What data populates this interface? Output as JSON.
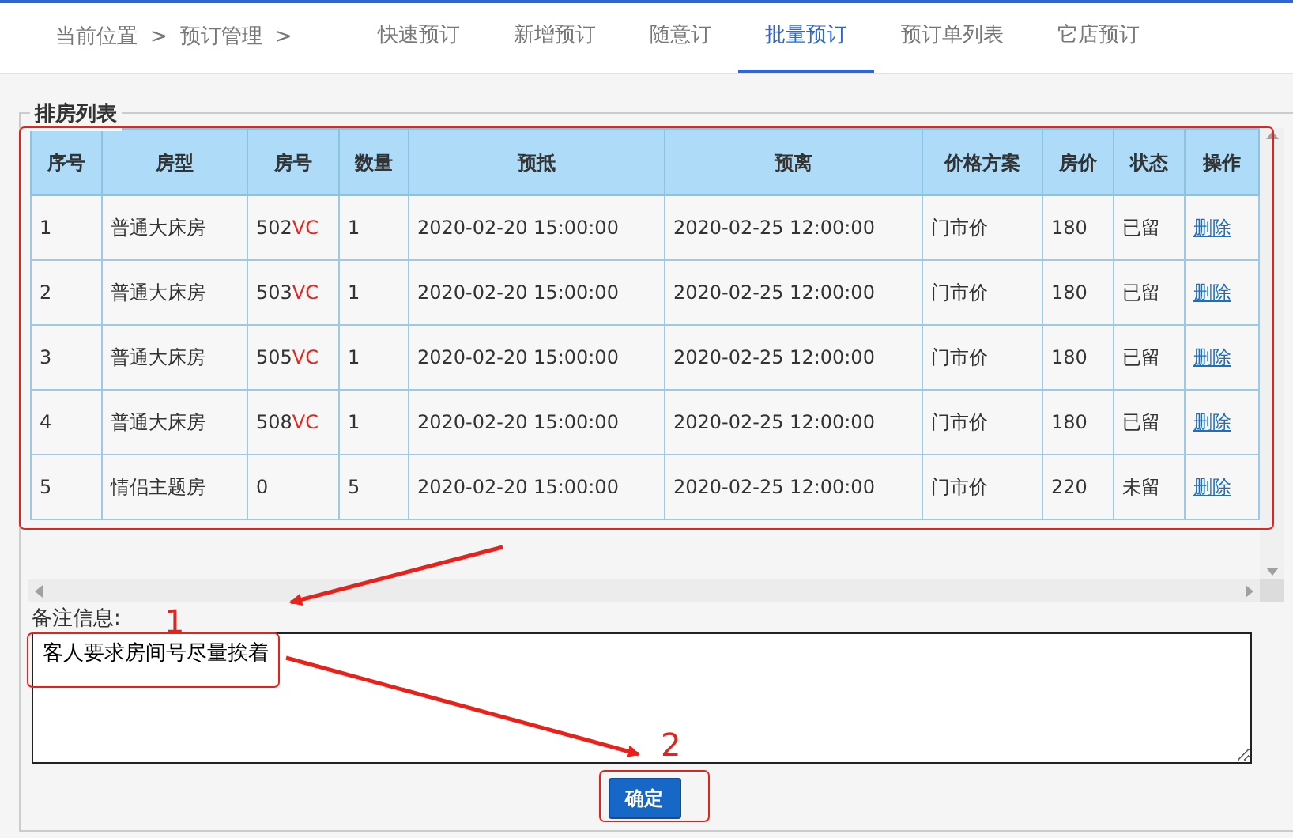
{
  "breadcrumb": [
    "当前位置",
    ">",
    "预订管理",
    ">"
  ],
  "tabs": [
    {
      "label": "快速预订",
      "selected": false
    },
    {
      "label": "新增预订",
      "selected": false
    },
    {
      "label": "随意订",
      "selected": false
    },
    {
      "label": "批量预订",
      "selected": true
    },
    {
      "label": "预订单列表",
      "selected": false
    },
    {
      "label": "它店预订",
      "selected": false
    }
  ],
  "panel": {
    "legend": "排房列表"
  },
  "table": {
    "columns": [
      "序号",
      "房型",
      "房号",
      "数量",
      "预抵",
      "预离",
      "价格方案",
      "房价",
      "状态",
      "操作"
    ],
    "rows": [
      {
        "index": "1",
        "room_type": "普通大床房",
        "room_no": "502",
        "room_flag": "VC",
        "count": "1",
        "arrival": "2020-02-20 15:00:00",
        "departure": "2020-02-25 12:00:00",
        "plan": "门市价",
        "price": "180",
        "status": "已留",
        "action": "删除"
      },
      {
        "index": "2",
        "room_type": "普通大床房",
        "room_no": "503",
        "room_flag": "VC",
        "count": "1",
        "arrival": "2020-02-20 15:00:00",
        "departure": "2020-02-25 12:00:00",
        "plan": "门市价",
        "price": "180",
        "status": "已留",
        "action": "删除"
      },
      {
        "index": "3",
        "room_type": "普通大床房",
        "room_no": "505",
        "room_flag": "VC",
        "count": "1",
        "arrival": "2020-02-20 15:00:00",
        "departure": "2020-02-25 12:00:00",
        "plan": "门市价",
        "price": "180",
        "status": "已留",
        "action": "删除"
      },
      {
        "index": "4",
        "room_type": "普通大床房",
        "room_no": "508",
        "room_flag": "VC",
        "count": "1",
        "arrival": "2020-02-20 15:00:00",
        "departure": "2020-02-25 12:00:00",
        "plan": "门市价",
        "price": "180",
        "status": "已留",
        "action": "删除"
      },
      {
        "index": "5",
        "room_type": "情侣主题房",
        "room_no": "0",
        "count": "5",
        "arrival": "2020-02-20 15:00:00",
        "departure": "2020-02-25 12:00:00",
        "plan": "门市价",
        "price": "220",
        "status": "未留",
        "action": "删除"
      }
    ]
  },
  "remarks": {
    "label": "备注信息:",
    "value": "客人要求房间号尽量挨着"
  },
  "buttons": [
    "确定"
  ],
  "annotations": [
    "1",
    "2"
  ]
}
